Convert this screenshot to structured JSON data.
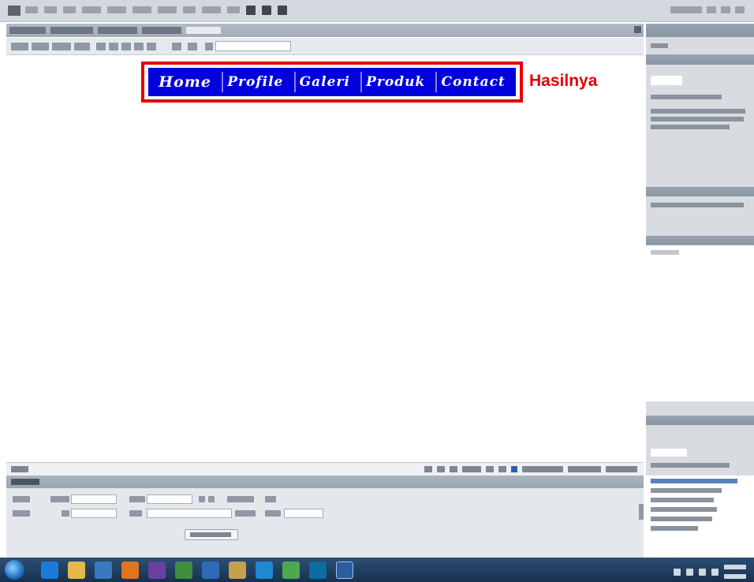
{
  "canvas": {
    "nav_items": [
      "Home",
      "Profile",
      "Galeri",
      "Produk",
      "Contact"
    ],
    "result_label": "Hasilnya"
  },
  "colors": {
    "nav_background": "#0000dd",
    "highlight_border": "#e30000",
    "result_label": "#e30000"
  },
  "icons": [
    "dreamweaver-logo-icon",
    "windows-start-icon",
    "internet-explorer-icon",
    "folder-icon",
    "media-player-icon",
    "firefox-icon",
    "dreamweaver-taskbar-icon"
  ]
}
